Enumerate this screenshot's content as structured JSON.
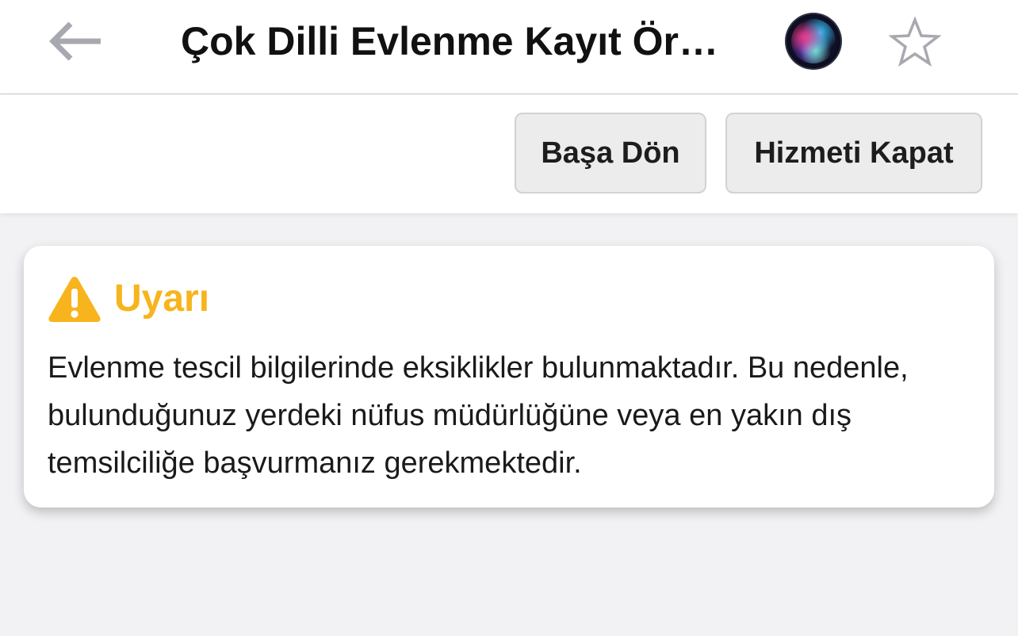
{
  "nav": {
    "title": "Çok Dilli Evlenme Kayıt Ör…",
    "back_icon": "arrow-left-icon",
    "siri_icon": "siri-icon",
    "favorite_icon": "star-outline-icon"
  },
  "actions": {
    "home_label": "Başa Dön",
    "close_label": "Hizmeti Kapat"
  },
  "alert": {
    "icon": "warning-triangle-icon",
    "title": "Uyarı",
    "message": "Evlenme tescil bilgilerinde eksiklikler bulunmaktadır. Bu nedenle, bulunduğunuz yerdeki nüfus müdürlüğüne veya en yakın dış temsilciliğe başvurmanız gerekmektedir."
  },
  "colors": {
    "accent_warning": "#f7b41c",
    "icon_gray": "#a8a8b0",
    "background": "#f2f2f5"
  }
}
